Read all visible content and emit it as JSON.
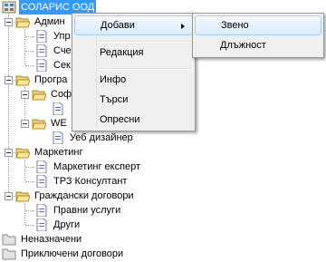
{
  "tree": {
    "root": "СОЛАРИС ООД",
    "items": [
      "Админ",
      "Упр",
      "Сче",
      "Сек",
      "Програ",
      "Соф",
      "",
      "WE",
      "Уеб дизайнер",
      "Маркетинг",
      "Маркетинг експерт",
      "ТРЗ Консултант",
      "Граждански договори",
      "Правни услуги",
      "Други",
      "Неназначени",
      "Приключени договори"
    ]
  },
  "context_menu": {
    "items": [
      "Добави",
      "Редакция",
      "Инфо",
      "Търси",
      "Опресни"
    ]
  },
  "submenu": {
    "items": [
      "Звено",
      "Длъжност"
    ]
  },
  "colors": {
    "selection": "#3399ff",
    "folder": "#f5d36a"
  }
}
